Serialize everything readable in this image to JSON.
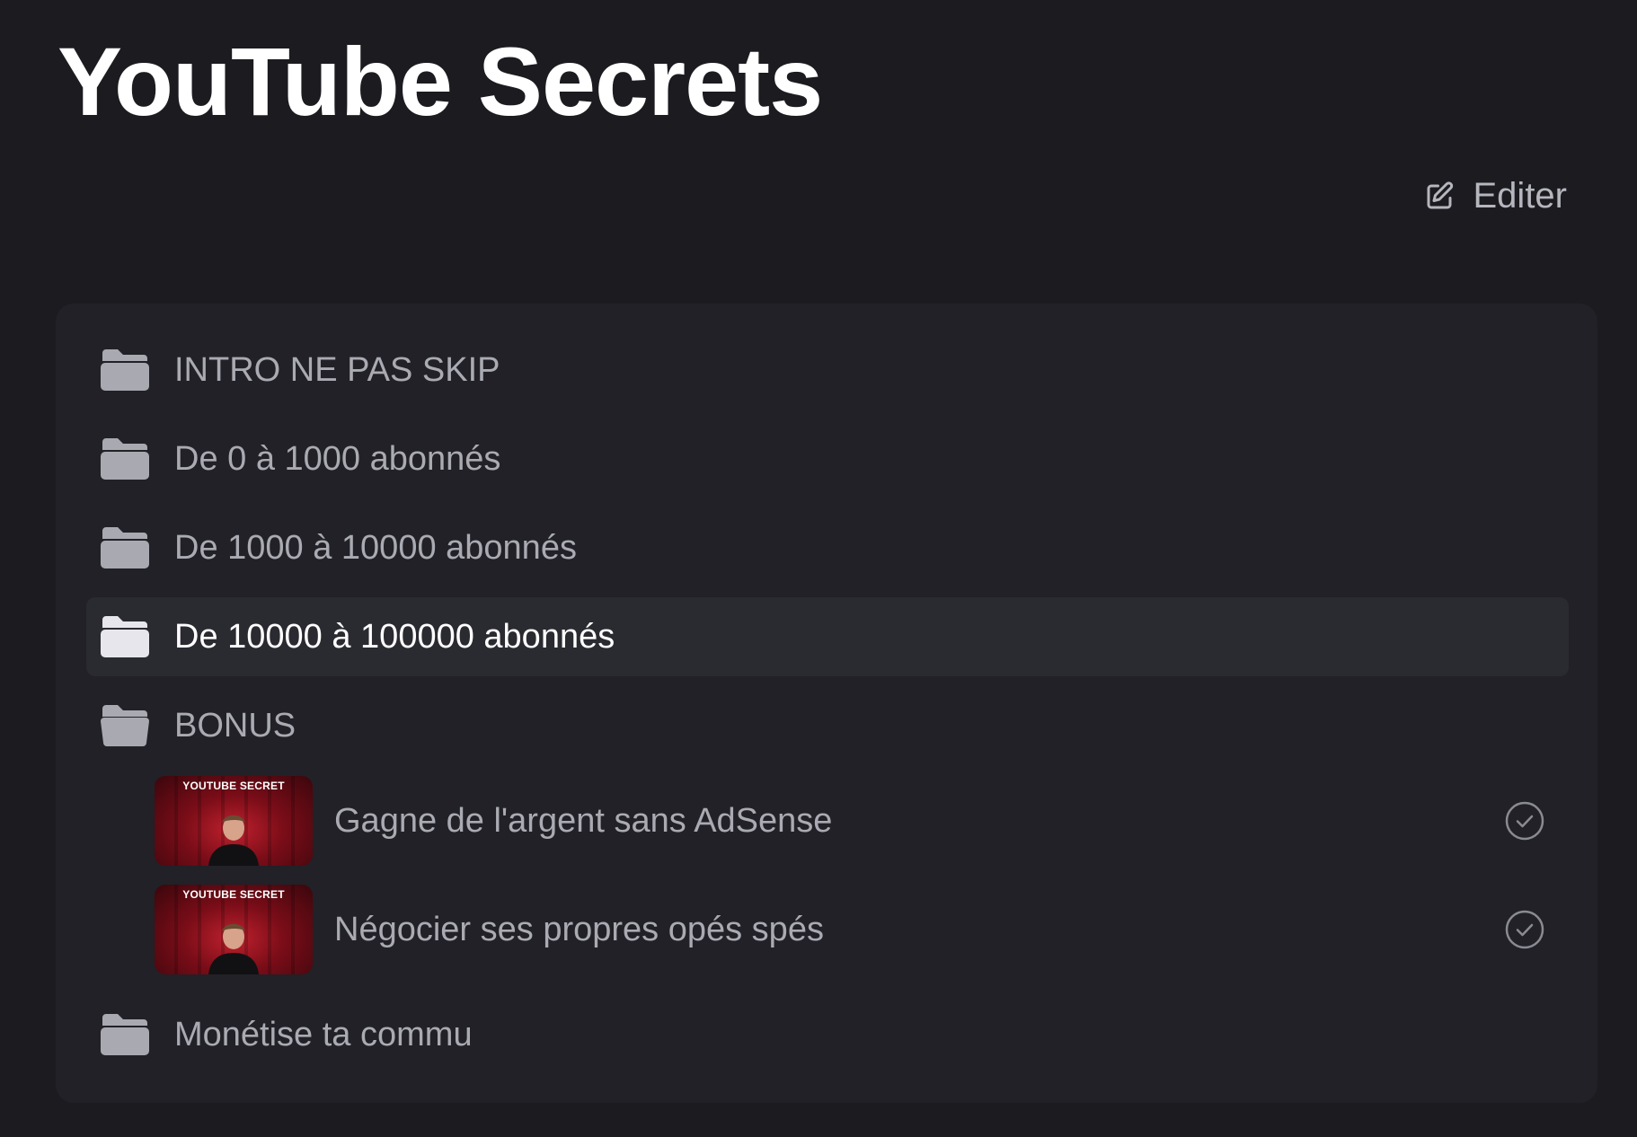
{
  "page": {
    "title": "YouTube Secrets"
  },
  "toolbar": {
    "edit_label": "Editer",
    "edit_icon": "pencil-square-icon"
  },
  "course": {
    "folders": [
      {
        "label": "INTRO NE PAS SKIP",
        "icon": "folder-icon",
        "active": false
      },
      {
        "label": "De 0 à 1000 abonnés",
        "icon": "folder-icon",
        "active": false
      },
      {
        "label": "De 1000 à 10000 abonnés",
        "icon": "folder-icon",
        "active": false
      },
      {
        "label": "De 10000 à 100000 abonnés",
        "icon": "folder-icon",
        "active": true
      },
      {
        "label": "BONUS",
        "icon": "folder-icon",
        "active": false,
        "expanded": true
      },
      {
        "label": "Monétise ta commu",
        "icon": "folder-icon",
        "active": false
      }
    ],
    "bonus_lessons": [
      {
        "title": "Gagne de l'argent sans AdSense",
        "thumbnail_text": "YOUTUBE SECRET",
        "completed": true,
        "status_icon": "check-circle-icon"
      },
      {
        "title": "Négocier ses propres opés spés",
        "thumbnail_text": "YOUTUBE SECRET",
        "completed": true,
        "status_icon": "check-circle-icon"
      }
    ]
  },
  "colors": {
    "background": "#1b1b20",
    "panel": "#212127",
    "active_row": "#2a2a31",
    "text_muted": "#aaaab3",
    "text_active": "#ffffff",
    "thumbnail_red": "#c0212e"
  }
}
